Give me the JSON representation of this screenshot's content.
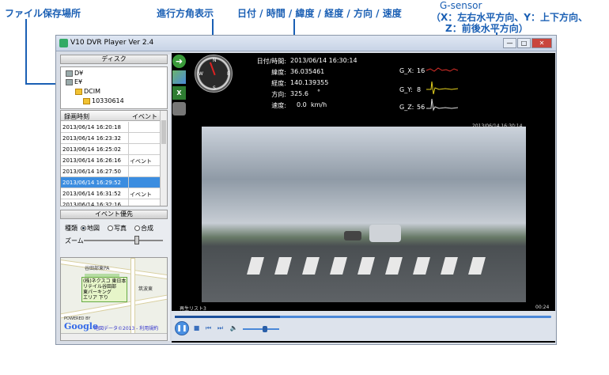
{
  "annotations": {
    "folder_label": "ファイル保存場所",
    "heading_label": "進行方角表示",
    "info_label": "日付 / 時間 / 緯度 / 経度 / 方向 / 速度",
    "gsensor_title": "G-sensor",
    "gsensor_line1": "（X：左右水平方向、Y：上下方向、",
    "gsensor_line2": "Z：前後水平方向）"
  },
  "window": {
    "title": "V10 DVR Player Ver 2.4",
    "min": "—",
    "max": "□",
    "close": "✕"
  },
  "left": {
    "disk_button": "ディスク",
    "tree": [
      {
        "label": "D¥",
        "icon": "drive-icon"
      },
      {
        "label": "E¥",
        "icon": "drive-icon"
      },
      {
        "label": "DCIM",
        "icon": "folder-icon"
      },
      {
        "label": "10330614",
        "icon": "folder-icon"
      }
    ],
    "list_header": {
      "time": "録画時刻",
      "event": "イベント"
    },
    "rows": [
      {
        "time": "2013/06/14 16:20:18",
        "event": ""
      },
      {
        "time": "2013/06/14 16:23:32",
        "event": ""
      },
      {
        "time": "2013/06/14 16:25:02",
        "event": ""
      },
      {
        "time": "2013/06/14 16:26:16",
        "event": "イベント"
      },
      {
        "time": "2013/06/14 16:27:50",
        "event": ""
      },
      {
        "time": "2013/06/14 16:29:52",
        "event": "",
        "selected": true
      },
      {
        "time": "2013/06/14 16:31:52",
        "event": "イベント"
      },
      {
        "time": "2013/06/14 16:32:16",
        "event": ""
      }
    ],
    "event_priority_button": "イベント優先",
    "kind_label": "種類",
    "kind_options": [
      "地図",
      "写真",
      "合成"
    ],
    "kind_selected": "地図",
    "zoom_label": "ズーム",
    "zoom_level": 0.68
  },
  "map": {
    "place1": "谷田部東PA",
    "place2": "(株)ネクスコ 東日本\nリテイル谷田部\n東パーキング\nエリア 下り",
    "place3": "筑波東",
    "powered": "POWERED BY",
    "google": "Google",
    "footer": "地図データ©2013 - 利用規約"
  },
  "info": {
    "datetime_label": "日付/時間:",
    "datetime": "2013/06/14 16:30:14",
    "lat_label": "緯度:",
    "lat": "36.035461",
    "lon_label": "経度:",
    "lon": "140.139355",
    "dir_label": "方向:",
    "dir": "325.6",
    "dir_unit": "°",
    "speed_label": "速度:",
    "speed": "0.0",
    "speed_unit": "km/h"
  },
  "gsensor": {
    "x_label": "G_X:",
    "x_value": "16",
    "y_label": "G_Y:",
    "y_value": "8",
    "z_label": "G_Z:",
    "z_value": "56",
    "colors": {
      "x": "#e0302a",
      "y": "#e6d21e",
      "z": "#dddddd"
    }
  },
  "video": {
    "timestamp": "2013/06/14 16:30:14",
    "playlist_label": "再生リスト3",
    "elapsed": "00:24",
    "progress": 0.28,
    "volume": 0.62
  }
}
